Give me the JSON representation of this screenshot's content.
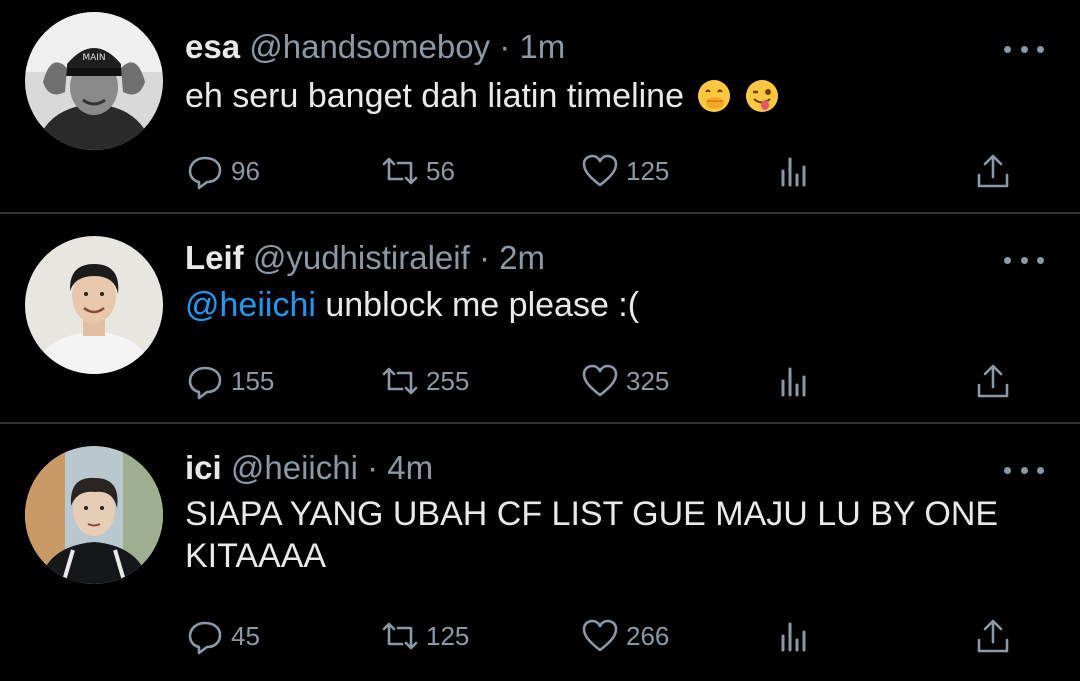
{
  "tweets": [
    {
      "name": "esa",
      "handle": "@handsomeboy",
      "separator": "·",
      "time": "1m",
      "text": "eh seru banget dah liatin timeline",
      "emojis": [
        "face-with-hand-over-mouth",
        "winking-face-with-tongue"
      ],
      "replies": "96",
      "retweets": "56",
      "likes": "125"
    },
    {
      "name": "Leif",
      "handle": "@yudhistiraleif",
      "separator": "·",
      "time": "2m",
      "mention": "@heiichi",
      "text": " unblock me please :(",
      "replies": "155",
      "retweets": "255",
      "likes": "325"
    },
    {
      "name": "ici",
      "handle": "@heiichi",
      "separator": "·",
      "time": "4m",
      "text": "SIAPA YANG UBAH CF LIST GUE MAJU LU BY ONE KITAAAA",
      "replies": "45",
      "retweets": "125",
      "likes": "266"
    }
  ],
  "icons": {
    "reply": "reply-icon",
    "retweet": "retweet-icon",
    "like": "heart-icon",
    "analytics": "analytics-icon",
    "share": "share-icon",
    "more": "more-options-icon"
  },
  "colors": {
    "background": "#000000",
    "text": "#e7e9ea",
    "secondary": "#8b98a5",
    "mention": "#1d9bf0",
    "divider": "#2f3336"
  }
}
